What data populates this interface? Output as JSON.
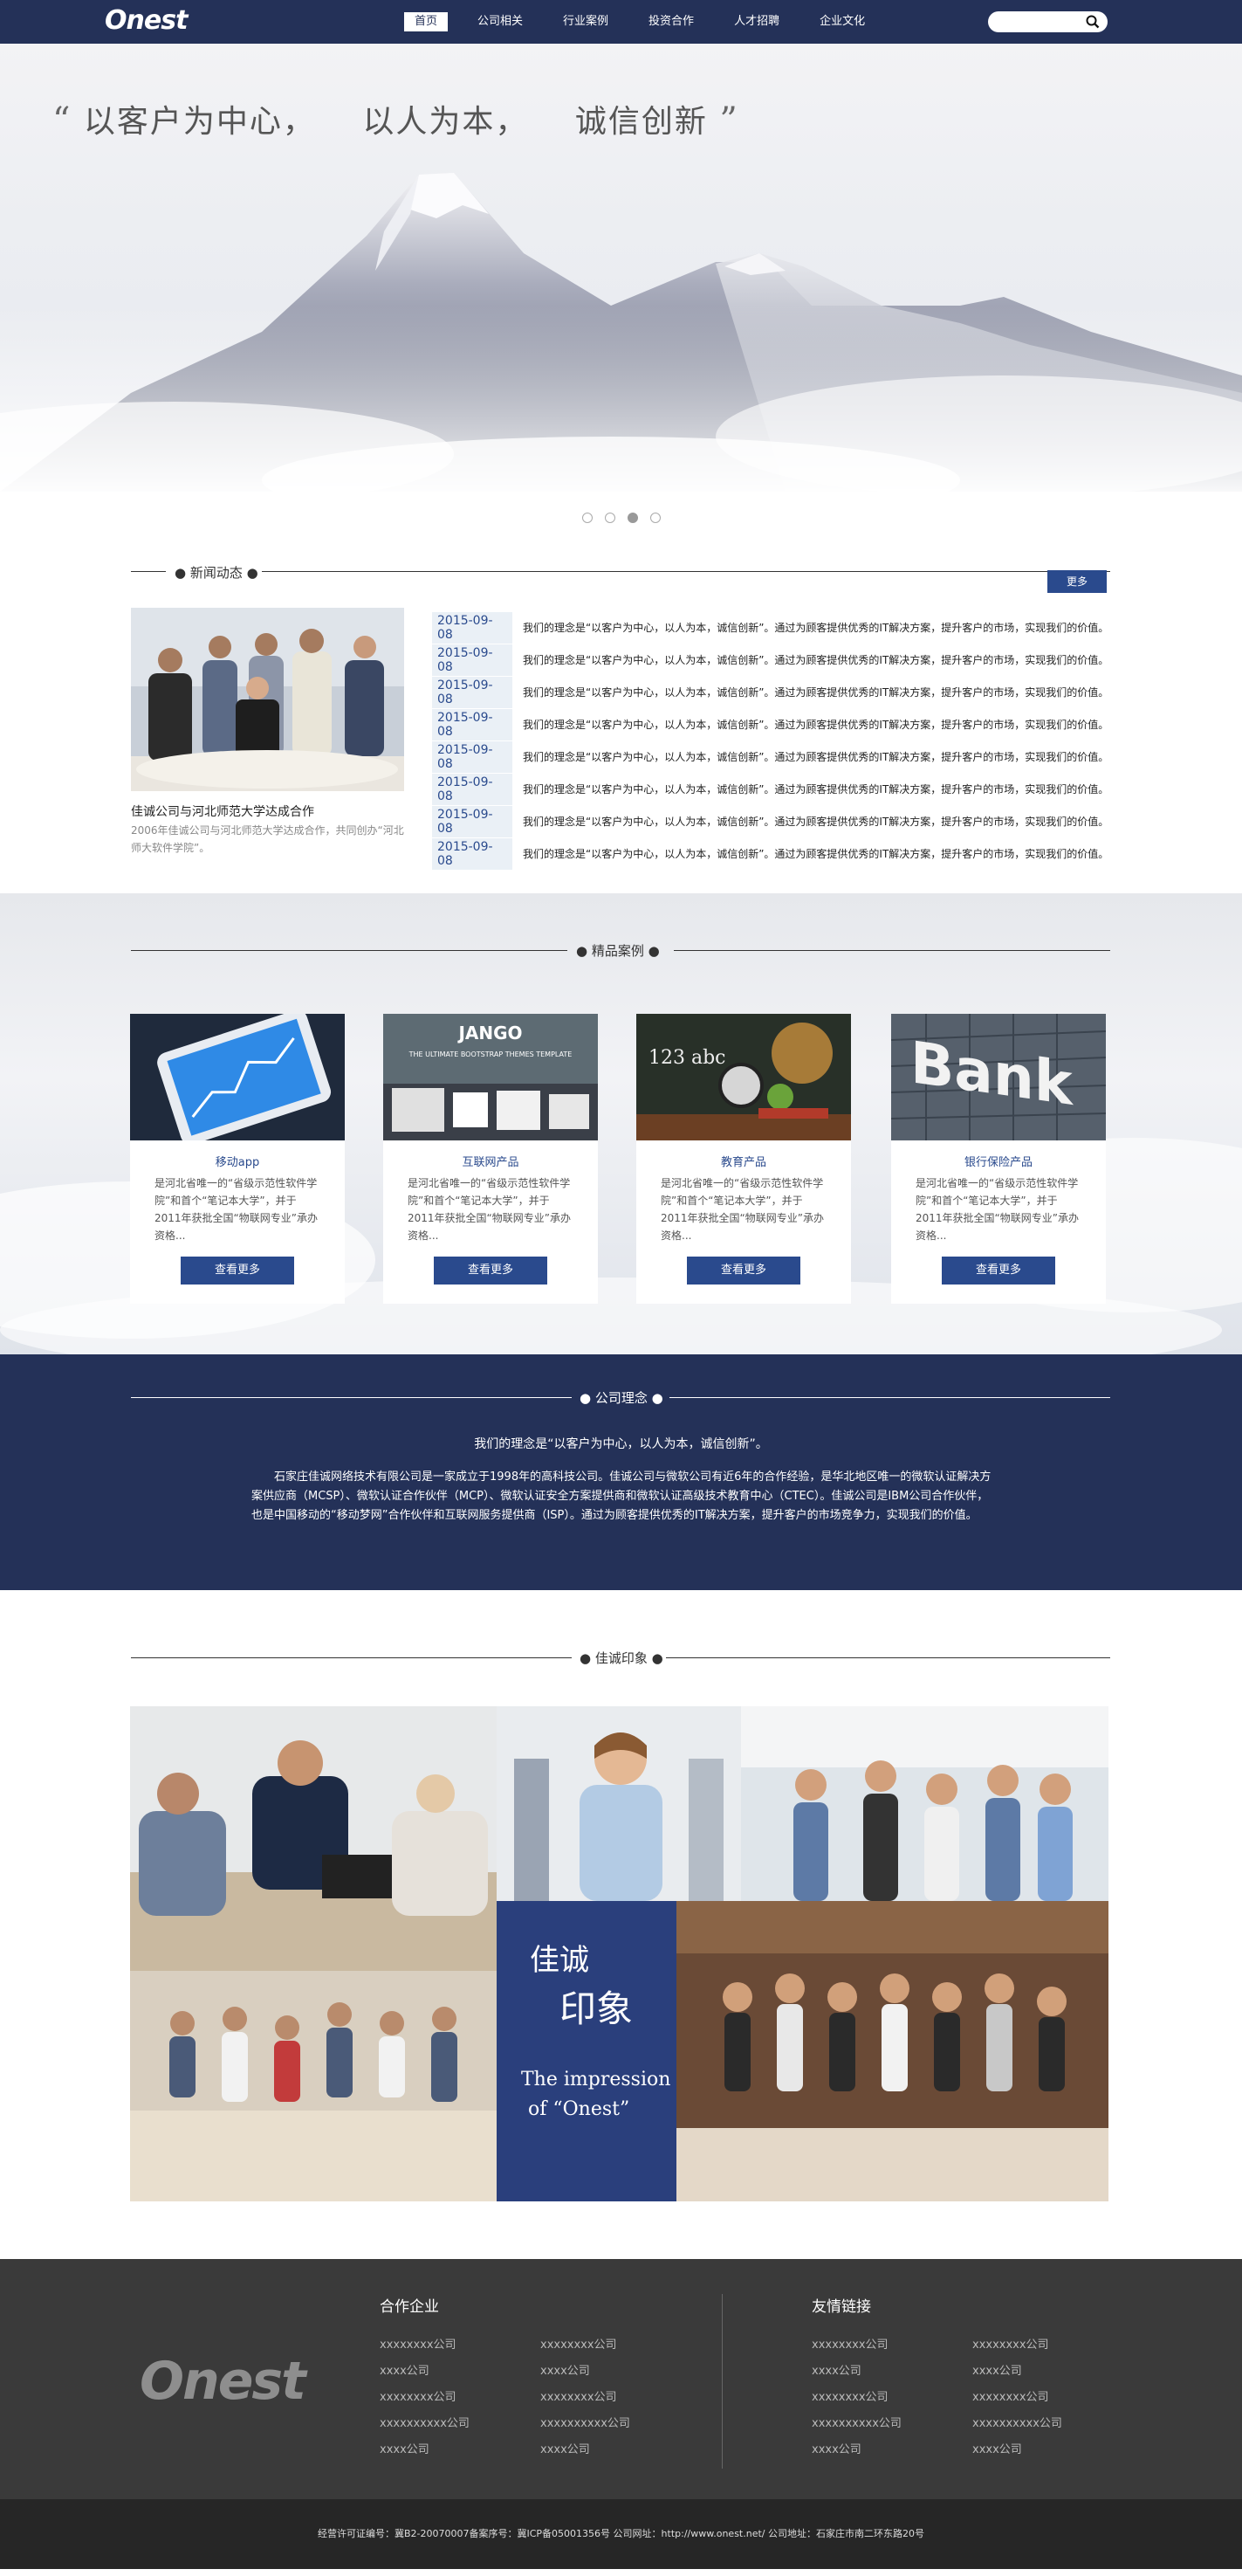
{
  "header": {
    "logo": "Onest",
    "nav": [
      "首页",
      "公司相关",
      "行业案例",
      "投资合作",
      "人才招聘",
      "企业文化"
    ],
    "search_placeholder": ""
  },
  "hero": {
    "slogan_open": "“",
    "slogan_1": "以客户为中心，",
    "slogan_2": "以人为本，",
    "slogan_3": "诚信创新",
    "slogan_close": "”",
    "dots_count": 4,
    "active_dot": 3
  },
  "news": {
    "title": "新闻动态",
    "more": "更多",
    "caption": "佳诚公司与河北师范大学达成合作",
    "desc": "2006年佳诚公司与河北师范大学达成合作，共同创办“河北师大软件学院”。",
    "items": [
      {
        "date": "2015-09-08",
        "text": "我们的理念是“以客户为中心，以人为本，诚信创新”。通过为顾客提供优秀的IT解决方案，提升客户的市场，实现我们的价值。"
      },
      {
        "date": "2015-09-08",
        "text": "我们的理念是“以客户为中心，以人为本，诚信创新”。通过为顾客提供优秀的IT解决方案，提升客户的市场，实现我们的价值。"
      },
      {
        "date": "2015-09-08",
        "text": "我们的理念是“以客户为中心，以人为本，诚信创新”。通过为顾客提供优秀的IT解决方案，提升客户的市场，实现我们的价值。"
      },
      {
        "date": "2015-09-08",
        "text": "我们的理念是“以客户为中心，以人为本，诚信创新”。通过为顾客提供优秀的IT解决方案，提升客户的市场，实现我们的价值。"
      },
      {
        "date": "2015-09-08",
        "text": "我们的理念是“以客户为中心，以人为本，诚信创新”。通过为顾客提供优秀的IT解决方案，提升客户的市场，实现我们的价值。"
      },
      {
        "date": "2015-09-08",
        "text": "我们的理念是“以客户为中心，以人为本，诚信创新”。通过为顾客提供优秀的IT解决方案，提升客户的市场，实现我们的价值。"
      },
      {
        "date": "2015-09-08",
        "text": "我们的理念是“以客户为中心，以人为本，诚信创新”。通过为顾客提供优秀的IT解决方案，提升客户的市场，实现我们的价值。"
      },
      {
        "date": "2015-09-08",
        "text": "我们的理念是“以客户为中心，以人为本，诚信创新”。通过为顾客提供优秀的IT解决方案，提升客户的市场，实现我们的价值。"
      }
    ]
  },
  "cases": {
    "title": "精品案例",
    "items": [
      {
        "name": "移动app",
        "desc": "是河北省唯一的“省级示范性软件学院”和首个“笔记本大学”，并于2011年获批全国“物联网专业”承办资格...",
        "button": "查看更多",
        "image": "phone-app",
        "img_text": ""
      },
      {
        "name": "互联网产品",
        "desc": "是河北省唯一的“省级示范性软件学院”和首个“笔记本大学”，并于2011年获批全国“物联网专业”承办资格...",
        "button": "查看更多",
        "image": "website-template",
        "img_text": "JANGO",
        "img_sub": "THE ULTIMATE BOOTSTRAP THEMES TEMPLATE"
      },
      {
        "name": "教育产品",
        "desc": "是河北省唯一的“省级示范性软件学院”和首个“笔记本大学”，并于2011年获批全国“物联网专业”承办资格...",
        "button": "查看更多",
        "image": "classroom-globe",
        "img_text": "123 abc"
      },
      {
        "name": "银行保险产品",
        "desc": "是河北省唯一的“省级示范性软件学院”和首个“笔记本大学”，并于2011年获批全国“物联网专业”承办资格...",
        "button": "查看更多",
        "image": "bank-building",
        "img_text": "Bank"
      }
    ]
  },
  "philosophy": {
    "title": "公司理念",
    "headline": "我们的理念是“以客户为中心，以人为本，诚信创新”。",
    "body": "石家庄佳诚网络技术有限公司是一家成立于1998年的高科技公司。佳诚公司与微软公司有近6年的合作经验，是华北地区唯一的微软认证解决方案供应商（MCSP）、微软认证合作伙伴（MCP）、微软认证安全方案提供商和微软认证高级技术教育中心（CTEC）。佳诚公司是IBM公司合作伙伴，也是中国移动的“移动梦网”合作伙伴和互联网服务提供商（ISP）。通过为顾客提供优秀的IT解决方案，提升客户的市场竞争力，实现我们的价值。"
  },
  "impression": {
    "title": "佳诚印象",
    "card_t1": "佳诚",
    "card_t2": "印象",
    "card_en1": "The impression",
    "card_en2": "of “Onest”"
  },
  "footer": {
    "logo": "Onest",
    "partners_title": "合作企业",
    "partners": [
      "xxxxxxxx公司",
      "xxxxxxxx公司",
      "xxxx公司",
      "xxxx公司",
      "xxxxxxxx公司",
      "xxxxxxxx公司",
      "xxxxxxxxxx公司",
      "xxxxxxxxxx公司",
      "xxxx公司",
      "xxxx公司"
    ],
    "links_title": "友情链接",
    "links": [
      "xxxxxxxx公司",
      "xxxxxxxx公司",
      "xxxx公司",
      "xxxx公司",
      "xxxxxxxx公司",
      "xxxxxxxx公司",
      "xxxxxxxxxx公司",
      "xxxxxxxxxx公司",
      "xxxx公司",
      "xxxx公司"
    ],
    "bottom": "经营许可证编号：冀B2-20070007备案序号：冀ICP备05001356号   公司网址：http://www.onest.net/    公司地址：石家庄市南二环东路20号"
  },
  "colors": {
    "navy": "#243158",
    "accent": "#2a4a8d",
    "footer": "#3a3a3a"
  }
}
